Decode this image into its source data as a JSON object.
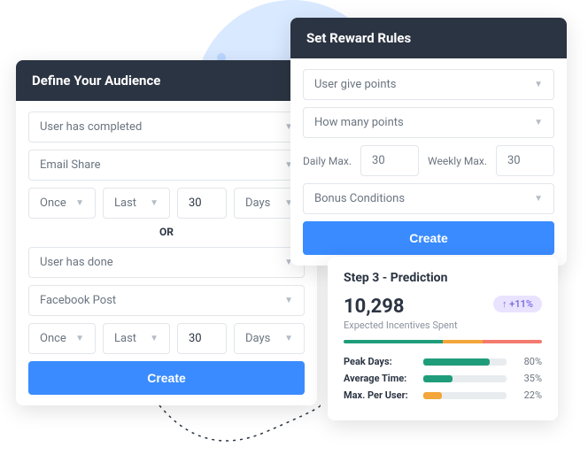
{
  "audience": {
    "title": "Define Your Audience",
    "group1": {
      "condition": "User has completed",
      "action": "Email Share",
      "freq": "Once",
      "timeframe": "Last",
      "value": "30",
      "unit": "Days"
    },
    "or_label": "OR",
    "group2": {
      "condition": "User has done",
      "action": "Facebook Post",
      "freq": "Once",
      "timeframe": "Last",
      "value": "30",
      "unit": "Days"
    },
    "create_label": "Create"
  },
  "reward": {
    "title": "Set Reward Rules",
    "rule": "User give points",
    "how_many": "How many points",
    "daily_label": "Daily Max.",
    "daily_value": "30",
    "weekly_label": "Weekly Max.",
    "weekly_value": "30",
    "bonus": "Bonus Conditions",
    "create_label": "Create"
  },
  "prediction": {
    "title": "Step 3 - Prediction",
    "number": "10,298",
    "badge": "↑ +11%",
    "sub": "Expected Incentives Spent",
    "segments": [
      {
        "color": "#1f9d7a",
        "width": "50%"
      },
      {
        "color": "#f3a63a",
        "width": "20%"
      },
      {
        "color": "#f47a6e",
        "width": "30%"
      }
    ],
    "stats": [
      {
        "label": "Peak Days:",
        "value": "80%",
        "pct": 80,
        "color": "#1f9d7a"
      },
      {
        "label": "Average Time:",
        "value": "35%",
        "pct": 35,
        "color": "#1f9d7a"
      },
      {
        "label": "Max. Per User:",
        "value": "22%",
        "pct": 22,
        "color": "#f3a63a"
      }
    ]
  }
}
